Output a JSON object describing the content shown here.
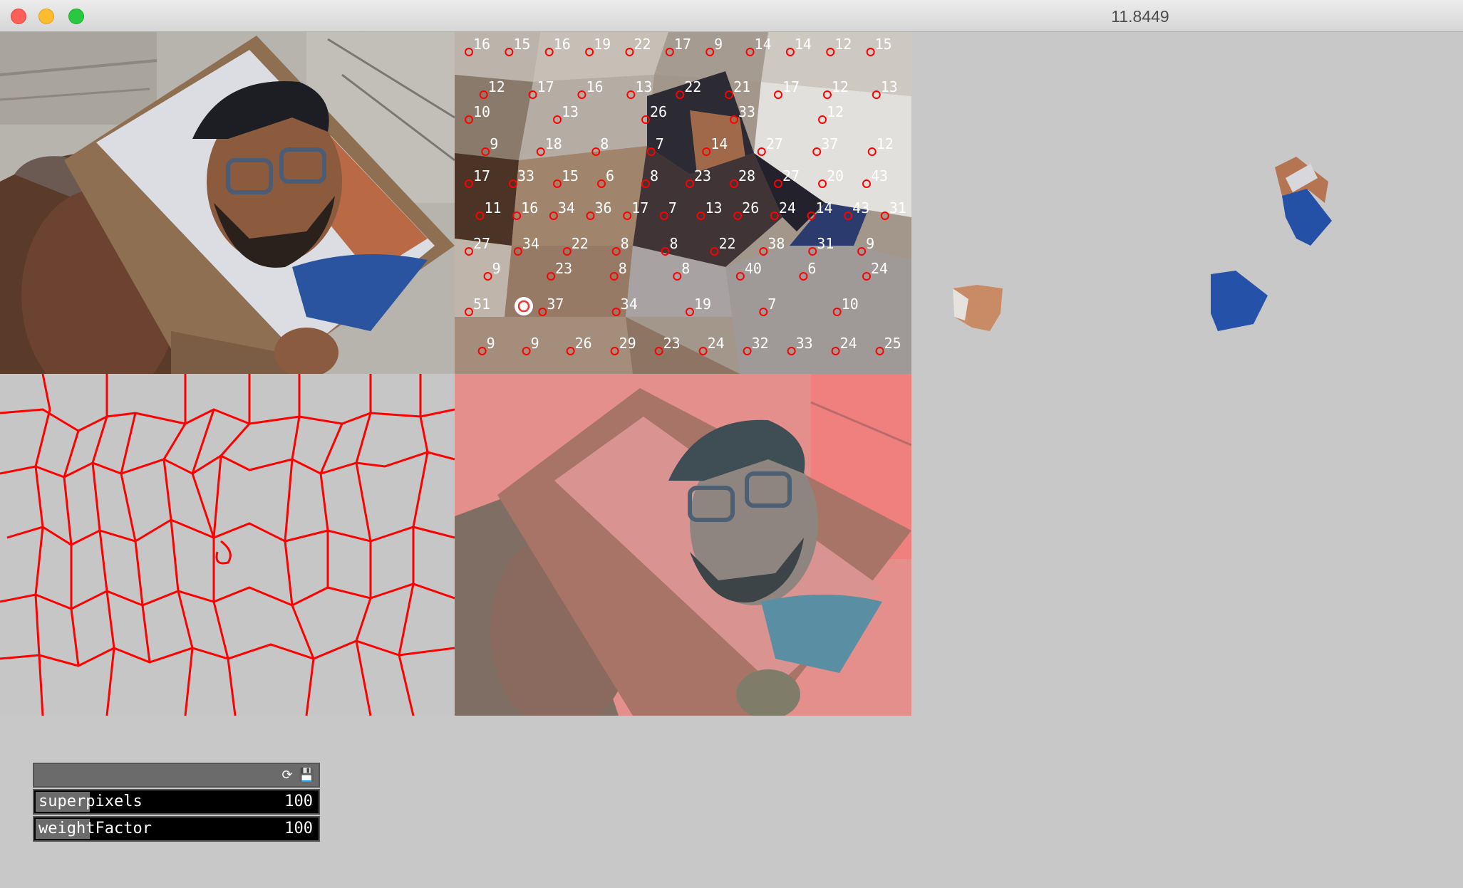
{
  "window": {
    "title": "11.8449",
    "buttons": [
      "close",
      "minimize",
      "maximize"
    ]
  },
  "panels": {
    "camera": "camera-feed",
    "superpixels": "superpixel-mean-color",
    "contours": "superpixel-contours",
    "tinted": "tinted-camera-feed",
    "segments": "selected-segments"
  },
  "superpixel_labels": [
    [
      "16",
      "15",
      "16",
      "19",
      "22",
      "17",
      "9",
      "14",
      "14",
      "12",
      "15"
    ],
    [
      "12",
      "17",
      "16",
      "13",
      "22",
      "21",
      "17",
      "12",
      "13"
    ],
    [
      "10",
      "13",
      "26",
      "33",
      "12"
    ],
    [
      "9",
      "18",
      "8",
      "7",
      "14",
      "27",
      "37",
      "12"
    ],
    [
      "17",
      "33",
      "15",
      "6",
      "8",
      "23",
      "28",
      "27",
      "20",
      "43"
    ],
    [
      "11",
      "16",
      "34",
      "36",
      "17",
      "7",
      "13",
      "26",
      "24",
      "14",
      "43",
      "31"
    ],
    [
      "27",
      "34",
      "22",
      "8",
      "8",
      "22",
      "38",
      "31",
      "9"
    ],
    [
      "9",
      "23",
      "8",
      "8",
      "40",
      "6",
      "24"
    ],
    [
      "51",
      "37",
      "34",
      "19",
      "7",
      "10"
    ],
    [
      "9",
      "9",
      "26",
      "29",
      "23",
      "24",
      "32",
      "33",
      "24",
      "25"
    ]
  ],
  "gui": {
    "icons": [
      "reload-icon",
      "save-icon"
    ],
    "sliders": [
      {
        "label": "superpixels",
        "value": "100"
      },
      {
        "label": "weightFactor",
        "value": "100"
      }
    ]
  },
  "colors": {
    "background": "#c8c8c8",
    "contour": "#ff0000",
    "center_marker": "#ff0000",
    "gui_bg": "#000000",
    "gui_fill": "#6b6b6b"
  }
}
